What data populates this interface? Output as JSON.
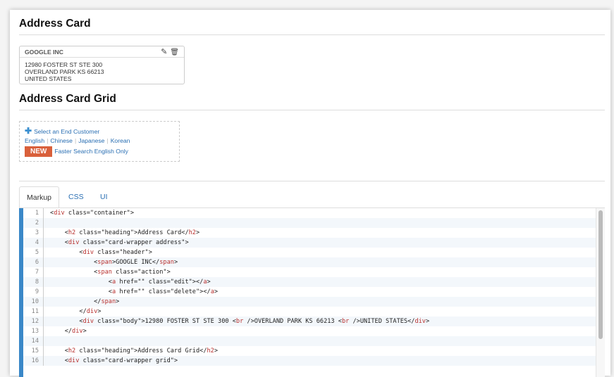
{
  "section1": {
    "title": "Address Card"
  },
  "card": {
    "name": "GOOGLE INC",
    "address": [
      "12980 FOSTER ST STE 300",
      "OVERLAND PARK KS 66213",
      "UNITED STATES"
    ],
    "edit_icon": "✎",
    "delete_icon": "🗑"
  },
  "section2": {
    "title": "Address Card Grid"
  },
  "grid": {
    "select_label": "Select an End Customer",
    "languages": [
      "English",
      "Chinese",
      "Japanese",
      "Korean"
    ],
    "badge": "NEW",
    "faster_search": "Faster Search English Only"
  },
  "tabs": [
    {
      "label": "Markup",
      "active": true
    },
    {
      "label": "CSS"
    },
    {
      "label": "UI"
    }
  ],
  "code_lines": [
    "<div class=\"container\">",
    "",
    "    <h2 class=\"heading\">Address Card</h2>",
    "    <div class=\"card-wrapper address\">",
    "        <div class=\"header\">",
    "            <span>GOOGLE INC</span>",
    "            <span class=\"action\">",
    "                <a href=\"\" class=\"edit\"></a>",
    "                <a href=\"\" class=\"delete\"></a>",
    "            </span>",
    "        </div>",
    "        <div class=\"body\">12980 FOSTER ST STE 300 <br />OVERLAND PARK KS 66213 <br />UNITED STATES</div>",
    "    </div>",
    "",
    "    <h2 class=\"heading\">Address Card Grid</h2>",
    "    <div class=\"card-wrapper grid\">"
  ]
}
